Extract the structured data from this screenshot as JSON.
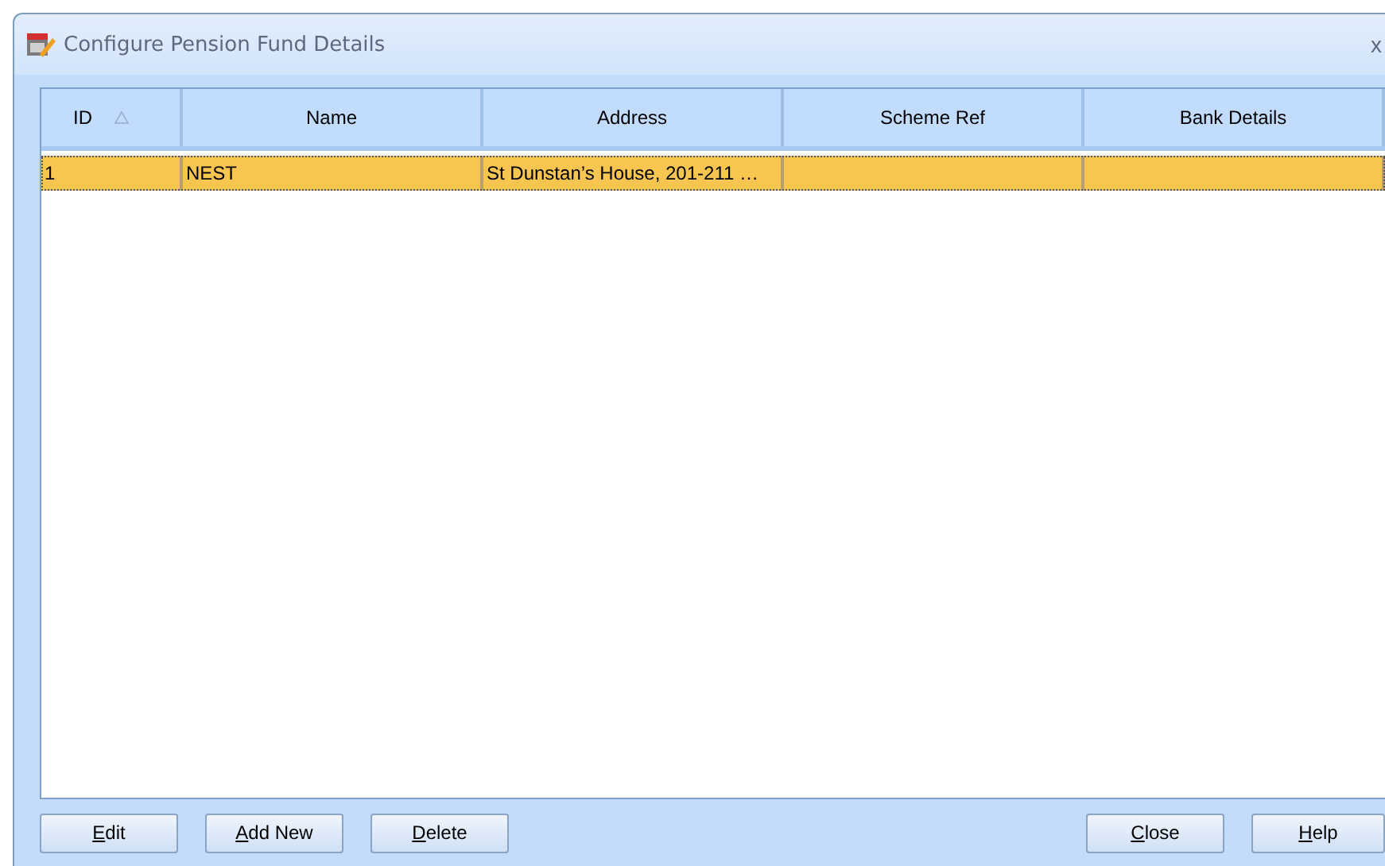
{
  "window": {
    "title": "Configure Pension Fund Details",
    "close_glyph": "x"
  },
  "table": {
    "columns": [
      {
        "label": "ID",
        "sorted": true
      },
      {
        "label": "Name",
        "sorted": false
      },
      {
        "label": "Address",
        "sorted": false
      },
      {
        "label": "Scheme Ref",
        "sorted": false
      },
      {
        "label": "Bank Details",
        "sorted": false
      }
    ],
    "rows": [
      {
        "selected": true,
        "cells": [
          "1",
          "NEST",
          "St Dunstan’s House, 201-211 …",
          "",
          ""
        ]
      }
    ]
  },
  "left_buttons": [
    {
      "mnemonic": "E",
      "rest": "dit"
    },
    {
      "mnemonic": "A",
      "rest": "dd New"
    },
    {
      "mnemonic": "D",
      "rest": "elete"
    }
  ],
  "right_buttons": [
    {
      "mnemonic": "C",
      "rest": "lose"
    },
    {
      "mnemonic": "H",
      "rest": "elp"
    }
  ]
}
